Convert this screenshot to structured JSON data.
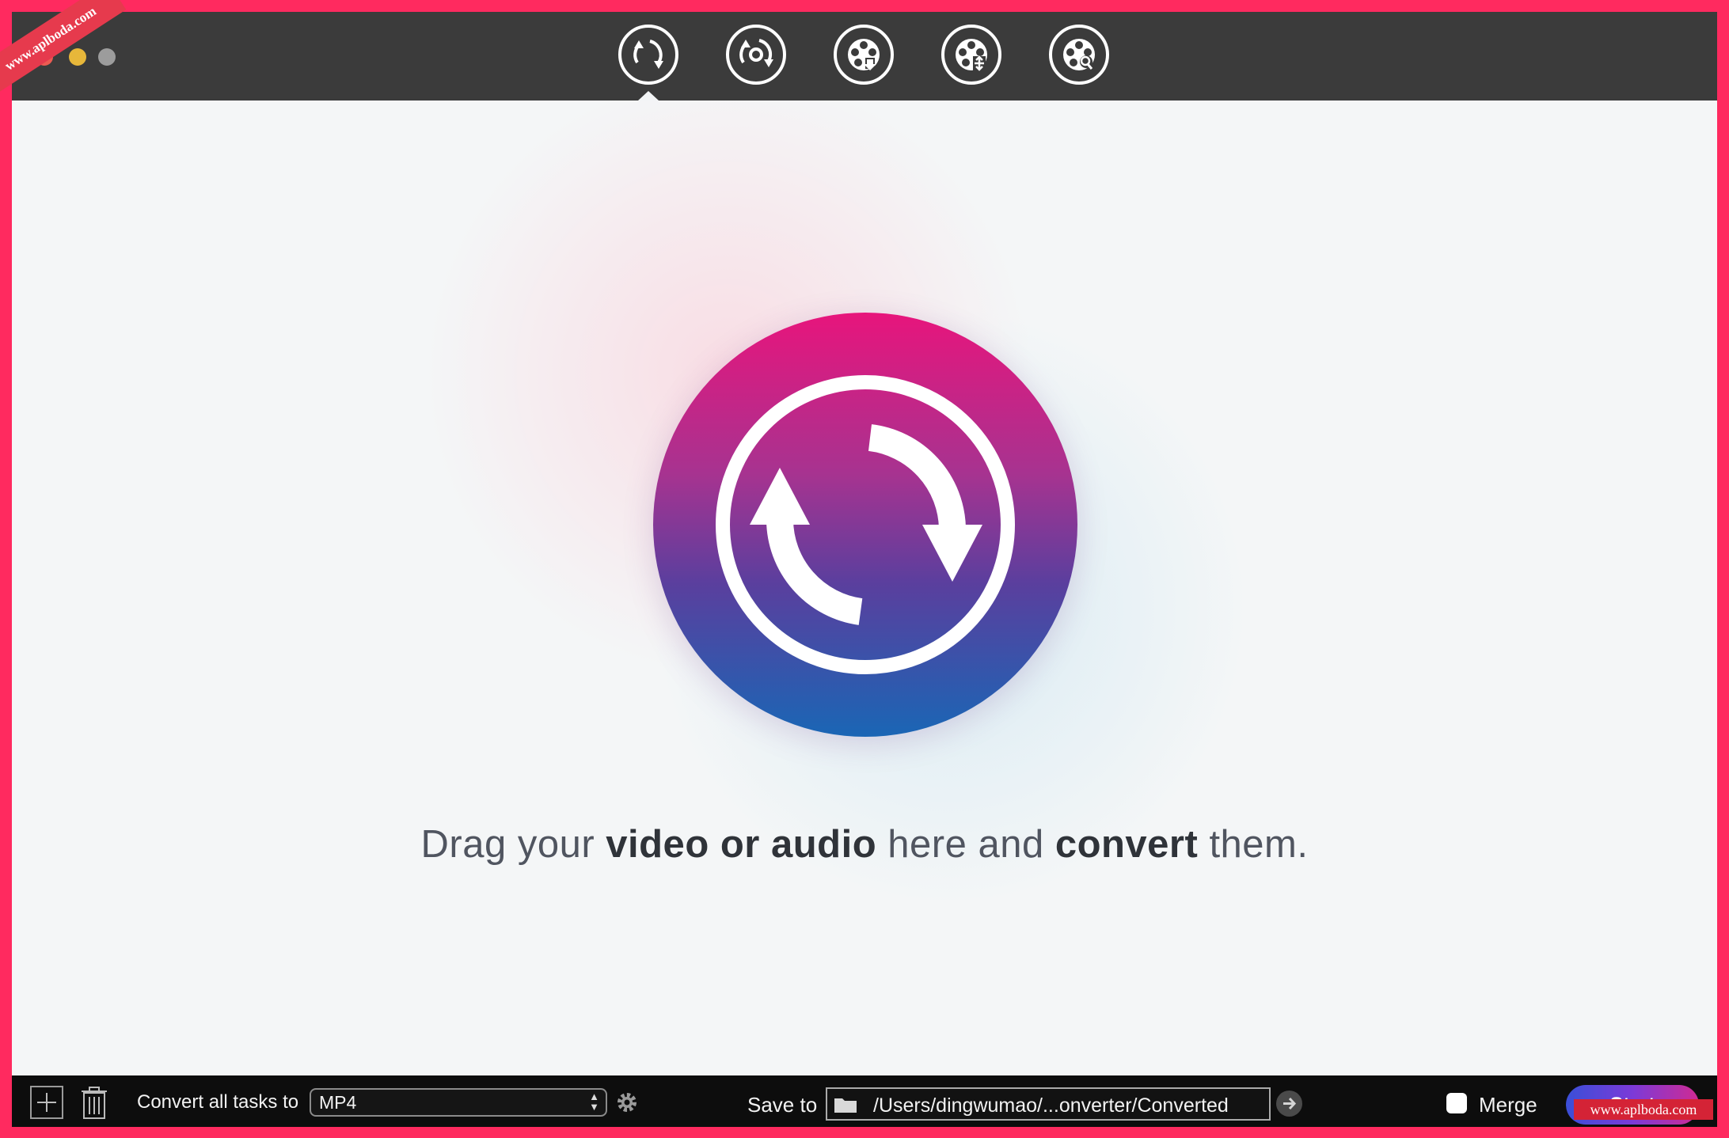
{
  "watermark": {
    "corner_text": "www.aplboda.com",
    "footer_text": "www.aplboda.com"
  },
  "toolbar": {
    "tools": [
      {
        "name": "convert",
        "icon": "convert-icon"
      },
      {
        "name": "rotate",
        "icon": "rotate-video-icon"
      },
      {
        "name": "download",
        "icon": "film-download-icon"
      },
      {
        "name": "compress",
        "icon": "film-compress-icon"
      },
      {
        "name": "record",
        "icon": "film-record-icon"
      }
    ],
    "selected_index": 0
  },
  "main": {
    "logo_icon": "convert-arrows-icon",
    "drop_text": {
      "part1": "Drag your ",
      "bold1": "video or audio",
      "part2": " here and ",
      "bold2": "convert",
      "part3": " them."
    }
  },
  "bottom_bar": {
    "convert_label": "Convert all tasks to",
    "format_value": "MP4",
    "save_label": "Save to",
    "save_path": "/Users/dingwumao/...onverter/Converted",
    "merge_label": "Merge",
    "merge_checked": false,
    "start_label": "Start"
  },
  "colors": {
    "accent_start": "#3a4fd8",
    "accent_end": "#d02a93",
    "logo_top": "#e7157c",
    "logo_bottom": "#1a66b5",
    "titlebar": "#3b3b3b"
  }
}
